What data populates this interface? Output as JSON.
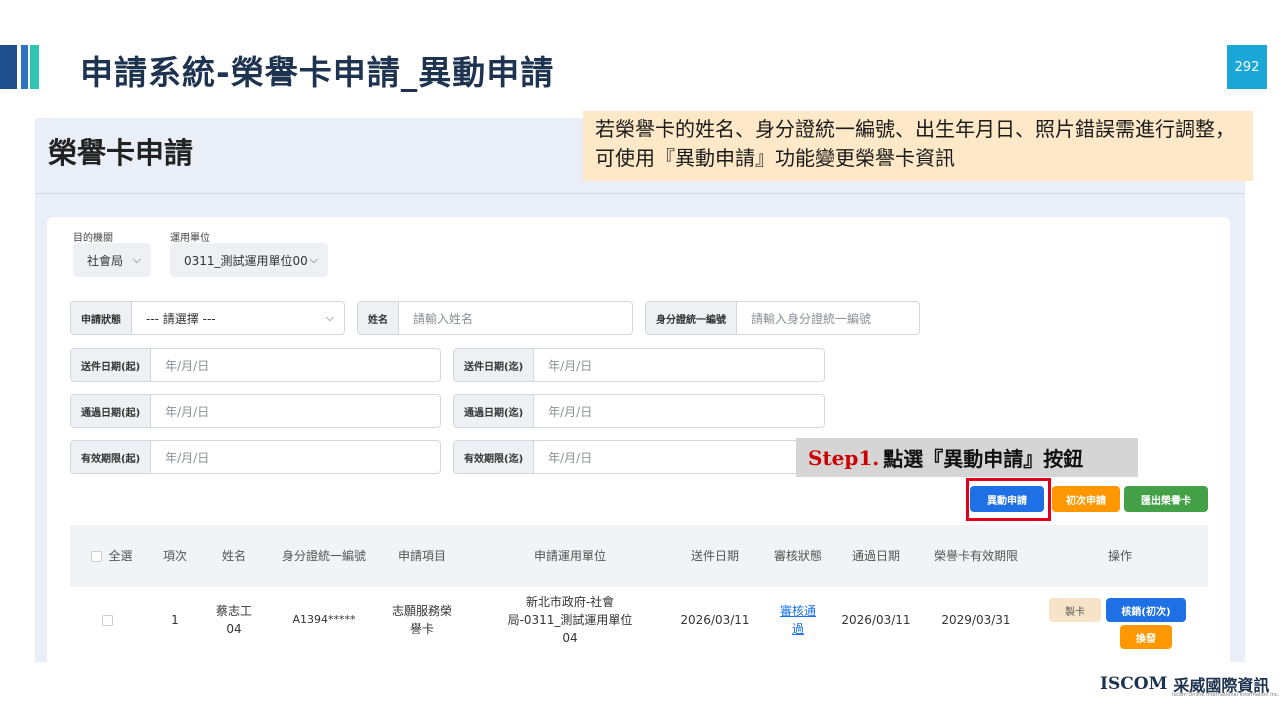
{
  "slide": {
    "title": "申請系統-榮譽卡申請_異動申請",
    "page_number": "292",
    "note": "若榮譽卡的姓名、身分證統一編號、出生年月日、照片錯誤需進行調整，可使用『異動申請』功能變更榮譽卡資訊",
    "step_prefix": "Step1.",
    "step_text": "點選『異動申請』按鈕",
    "logo_en": "ISCOM",
    "logo_cn": "采威國際資訊",
    "logo_sub": "Iscom Online International Information Inc."
  },
  "page": {
    "title": "榮譽卡申請",
    "filters": {
      "agency_label": "目的機關",
      "agency_value": "社會局",
      "unit_label": "運用單位",
      "unit_value": "0311_測試運用單位00",
      "status_label": "申請狀態",
      "status_value": "--- 請選擇 ---",
      "name_label": "姓名",
      "name_placeholder": "請輸入姓名",
      "id_label": "身分證統一編號",
      "id_placeholder": "請輸入身分證統一編號",
      "send_start_label": "送件日期(起)",
      "send_start_value": "年/月/日",
      "send_end_label": "送件日期(迄)",
      "send_end_value": "年/月/日",
      "pass_start_label": "通過日期(起)",
      "pass_start_value": "年/月/日",
      "pass_end_label": "通過日期(迄)",
      "pass_end_value": "年/月/日",
      "valid_start_label": "有效期限(起)",
      "valid_start_value": "年/月/日",
      "valid_end_label": "有效期限(迄)",
      "valid_end_value": "年/月/日"
    },
    "buttons": {
      "change": "異動申請",
      "first": "初次申請",
      "export": "匯出榮譽卡"
    },
    "table": {
      "headers": [
        "全選",
        "項次",
        "姓名",
        "身分證統一編號",
        "申請項目",
        "申請運用單位",
        "送件日期",
        "審核狀態",
        "通過日期",
        "榮譽卡有效期限",
        "操作"
      ],
      "row": {
        "index": "1",
        "name": "蔡志工04",
        "id": "A1394*****",
        "item": "志願服務榮譽卡",
        "unit": "新北市政府-社會局-0311_測試運用單位04",
        "send_date": "2026/03/11",
        "status": "審核通過",
        "pass_date": "2026/03/11",
        "valid_date": "2029/03/31",
        "actions": {
          "make": "製卡",
          "cancel": "核銷(初次)",
          "reissue": "換發"
        }
      }
    }
  }
}
